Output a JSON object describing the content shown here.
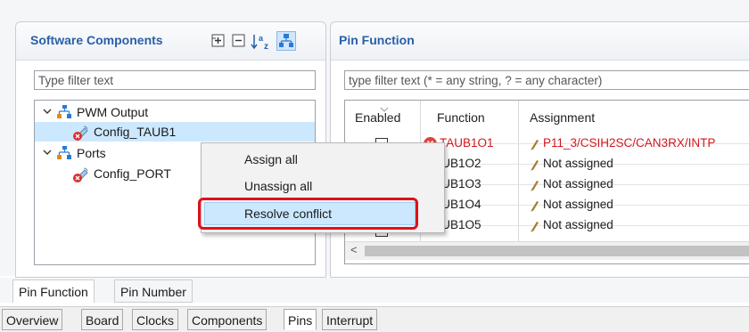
{
  "software_components": {
    "title": "Software Components",
    "toolbar": [
      "expand-all-icon",
      "collapse-all-icon",
      "sort-az-icon",
      "hierarchy-icon"
    ],
    "filter_placeholder": "Type filter text",
    "tree": [
      {
        "label": "PWM Output",
        "icon": "component-group-icon",
        "expanded": true,
        "children": [
          {
            "label": "Config_TAUB1",
            "icon": "error-config-icon",
            "selected": true
          }
        ]
      },
      {
        "label": "Ports",
        "icon": "component-group-icon",
        "expanded": true,
        "children": [
          {
            "label": "Config_PORT",
            "icon": "error-config-icon",
            "selected": false
          }
        ]
      }
    ]
  },
  "pin_function": {
    "title": "Pin Function",
    "filter_placeholder": "type filter text (* = any string, ? = any character)",
    "columns": [
      "Enabled",
      "Function",
      "Assignment"
    ],
    "rows": [
      {
        "function": "TAUB1O1",
        "assignment": "P11_3/CSIH2SC/CAN3RX/INTP",
        "error": true
      },
      {
        "function": "TAUB1O2",
        "assignment": "Not assigned",
        "error": false
      },
      {
        "function": "TAUB1O3",
        "assignment": "Not assigned",
        "error": false
      },
      {
        "function": "TAUB1O4",
        "assignment": "Not assigned",
        "error": false
      },
      {
        "function": "TAUB1O5",
        "assignment": "Not assigned",
        "error": false
      }
    ],
    "scroll_left_glyph": "<"
  },
  "context_menu": {
    "items": [
      "Assign all",
      "Unassign all",
      "Resolve conflict"
    ],
    "highlighted": "Resolve conflict"
  },
  "view_tabs": [
    "Pin Function",
    "Pin Number"
  ],
  "view_tabs_active": "Pin Function",
  "editor_tabs": [
    "Overview",
    "Board",
    "Clocks",
    "Components",
    "Pins",
    "Interrupt"
  ],
  "editor_tabs_active": "Pins",
  "colors": {
    "title_blue": "#2a5fa8",
    "error_red": "#d0191f",
    "highlight_outline": "#e0101a",
    "selection": "#cce8ff"
  }
}
